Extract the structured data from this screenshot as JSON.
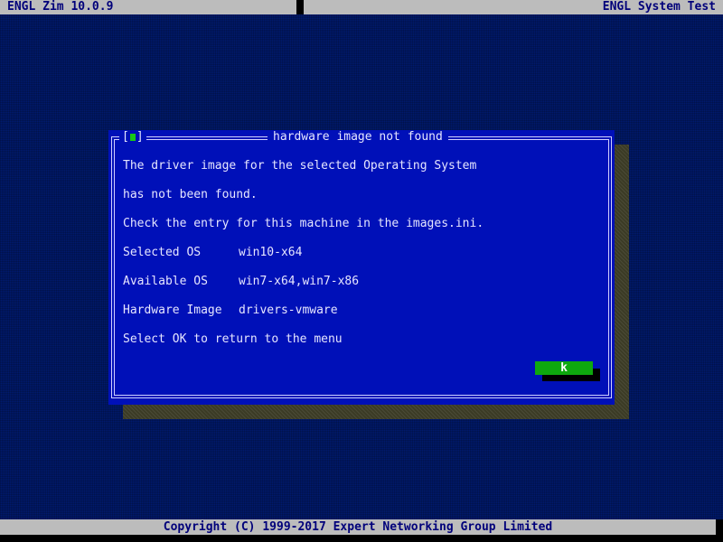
{
  "header": {
    "left_title": "ENGL Zim 10.0.9",
    "right_title": "ENGL System Test"
  },
  "dialog": {
    "close_label_open": "[",
    "close_label_close": "]",
    "title": "hardware image not found",
    "message_line1": "The driver image for the selected Operating System",
    "message_line2": "has not been found.",
    "message_line3": "Check the entry for this machine in the images.ini.",
    "selected_os_label": "Selected OS",
    "selected_os_value": "win10-x64",
    "available_os_label": "Available OS",
    "available_os_value": "win7-x64,win7-x86",
    "hardware_image_label": "Hardware Image",
    "hardware_image_value": "drivers-vmware",
    "instruction": "Select OK to return to the menu",
    "ok_label": "k"
  },
  "footer": {
    "copyright": "Copyright (C) 1999-2017 Expert Networking Group Limited"
  },
  "colors": {
    "desktop": "#001a6e",
    "bar": "#bcbcbc",
    "bar_text": "#00007a",
    "dialog_bg": "#0010b8",
    "dialog_text": "#e6e6ff",
    "ok_button": "#0ea80e",
    "close_mark": "#18c818"
  }
}
